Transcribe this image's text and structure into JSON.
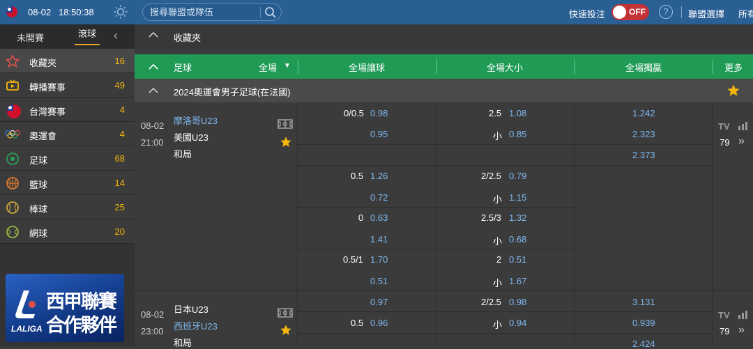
{
  "topbar": {
    "date": "08-02",
    "time": "18:50:38",
    "search_placeholder": "搜尋聯盟或隊伍",
    "quick_bet_label": "快速投注",
    "toggle_label": "OFF",
    "help": "?",
    "league_select": "聯盟選擇",
    "all": "所有"
  },
  "sidebar": {
    "tabs": [
      "未開賽",
      "滾球"
    ],
    "items": [
      {
        "label": "收藏夾",
        "count": "16",
        "icon": "star-icon"
      },
      {
        "label": "轉播賽事",
        "count": "49",
        "icon": "tv-icon"
      },
      {
        "label": "台灣賽事",
        "count": "4",
        "icon": "taiwan-flag-icon"
      },
      {
        "label": "奧運會",
        "count": "4",
        "icon": "olympic-rings-icon"
      },
      {
        "label": "足球",
        "count": "68",
        "icon": "soccer-ball-icon"
      },
      {
        "label": "籃球",
        "count": "14",
        "icon": "basketball-icon"
      },
      {
        "label": "棒球",
        "count": "25",
        "icon": "baseball-icon"
      },
      {
        "label": "網球",
        "count": "20",
        "icon": "tennis-ball-icon"
      }
    ],
    "banner": {
      "line1": "西甲聯賽",
      "line2": "合作夥伴",
      "brand": "LALIGA"
    }
  },
  "main": {
    "fav_title": "收藏夾",
    "header": {
      "sport": "足球",
      "period": "全場",
      "handicap": "全場讓球",
      "over_under": "全場大小",
      "moneyline": "全場獨贏",
      "more": "更多"
    },
    "league": "2024奧運會男子足球(在法國)",
    "matches": [
      {
        "date": "08-02",
        "time": "21:00",
        "home": "摩洛哥U23",
        "away": "美國U23",
        "draw": "和局",
        "tv": "TV",
        "more_count": "79",
        "handicap_rows": [
          {
            "line": "0/0.5",
            "odd1": "0.98",
            "odd2": "0.95"
          },
          {
            "line": "0.5",
            "odd1": "1.26",
            "odd2": "0.72"
          },
          {
            "line": "0",
            "odd1": "0.63",
            "odd2": "1.41"
          },
          {
            "line": "0.5/1",
            "odd1": "1.70",
            "odd2": "0.51"
          }
        ],
        "ou_rows": [
          {
            "line": "2.5",
            "odd1": "1.08",
            "under": "小",
            "odd2": "0.85"
          },
          {
            "line": "2/2.5",
            "odd1": "0.79",
            "under": "小",
            "odd2": "1.15"
          },
          {
            "line": "2.5/3",
            "odd1": "1.32",
            "under": "小",
            "odd2": "0.68"
          },
          {
            "line": "2",
            "odd1": "0.51",
            "under": "小",
            "odd2": "1.67"
          }
        ],
        "moneyline": [
          "1.242",
          "2.323",
          "2.373"
        ]
      },
      {
        "date": "08-02",
        "time": "23:00",
        "home": "日本U23",
        "away": "西班牙U23",
        "draw": "和局",
        "tv": "TV",
        "more_count": "79",
        "handicap_rows": [
          {
            "line": "",
            "odd1": "0.97",
            "odd2": ""
          },
          {
            "line": "0.5",
            "odd1": "0.96",
            "odd2": ""
          }
        ],
        "ou_rows": [
          {
            "line": "2/2.5",
            "odd1": "0.98",
            "under": "",
            "odd2": ""
          },
          {
            "line": "",
            "odd1": "",
            "under": "小",
            "odd2": "0.94"
          }
        ],
        "moneyline": [
          "3.131",
          "0.939",
          "2.424"
        ]
      }
    ]
  },
  "colors": {
    "topbar": "#2a5f94",
    "green_header": "#1f9b56",
    "odds_blue": "#7fb7ee",
    "count_yellow": "#f5b70a",
    "toggle_red": "#c33235"
  }
}
